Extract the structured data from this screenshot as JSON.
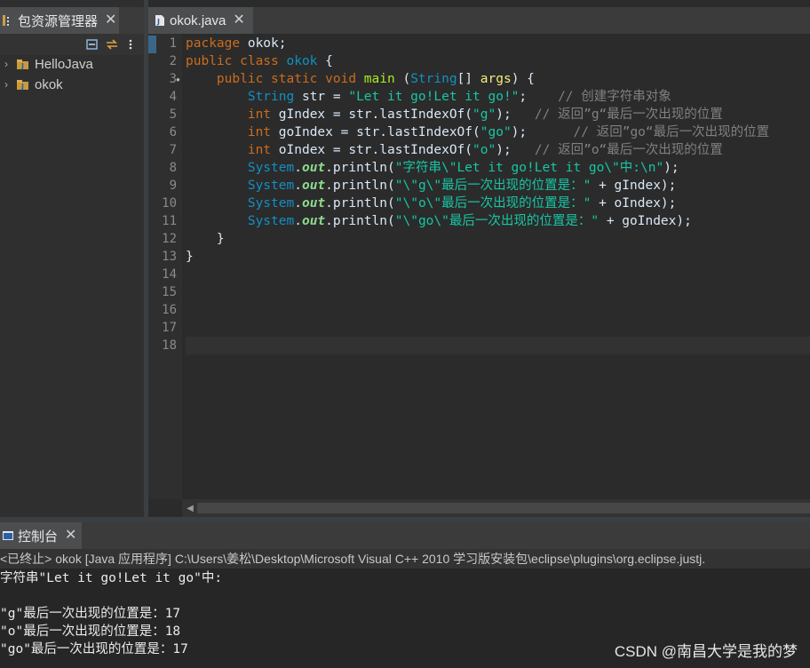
{
  "package_explorer": {
    "tab_label": "包资源管理器",
    "close": "✕",
    "projects": [
      {
        "label": "HelloJava"
      },
      {
        "label": "okok"
      }
    ]
  },
  "editor": {
    "tab_label": "okok.java",
    "close": "✕",
    "line_numbers": [
      "1",
      "2",
      "3",
      "4",
      "5",
      "6",
      "7",
      "8",
      "9",
      "10",
      "11",
      "12",
      "13",
      "14",
      "15",
      "16",
      "17",
      "18"
    ],
    "lines": {
      "l1_kw": "package",
      "l1_rest": " okok;",
      "l2_kw": "public class",
      "l2_name": " okok",
      "l2_rest": " {",
      "l3_kw": "public static void",
      "l3_name": " main",
      "l3_p1": " (",
      "l3_type": "String",
      "l3_p2": "[] ",
      "l3_args": "args",
      "l3_p3": ") {",
      "l4_type": "String",
      "l4_rest": " str = ",
      "l4_str": "\"Let it go!Let it go!\"",
      "l4_end": ";",
      "l4_cmt": "// 创建字符串对象",
      "l5_kw": "int",
      "l5_rest": " gIndex = str.lastIndexOf(",
      "l5_str": "\"g\"",
      "l5_end": ");",
      "l5_cmt": "// 返回”g“最后一次出现的位置",
      "l6_kw": "int",
      "l6_rest": " goIndex = str.lastIndexOf(",
      "l6_str": "\"go\"",
      "l6_end": ");",
      "l6_cmt": "// 返回”go“最后一次出现的位置",
      "l7_kw": "int",
      "l7_rest": " oIndex = str.lastIndexOf(",
      "l7_str": "\"o\"",
      "l7_end": ");",
      "l7_cmt": "// 返回”o“最后一次出现的位置",
      "sys": "System",
      "dot": ".",
      "out": "out",
      "println": ".println(",
      "l8_str": "\"字符串\\\"Let it go!Let it go\\\"中:\\n\"",
      "l8_end": ");",
      "l9_str": "\"\\\"g\\\"最后一次出现的位置是：\"",
      "l9_rest": " + gIndex);",
      "l10_str": "\"\\\"o\\\"最后一次出现的位置是：\"",
      "l10_rest": " + oIndex);",
      "l11_str": "\"\\\"go\\\"最后一次出现的位置是：\"",
      "l11_rest": " + goIndex);",
      "l12": "}",
      "l13": "}"
    }
  },
  "console": {
    "tab_label": "控制台",
    "close": "✕",
    "info": "<已终止> okok [Java 应用程序] C:\\Users\\姜松\\Desktop\\Microsoft Visual C++ 2010 学习版安装包\\eclipse\\plugins\\org.eclipse.justj.",
    "output": [
      "字符串\"Let it go!Let it go\"中:",
      "",
      "\"g\"最后一次出现的位置是：17",
      "\"o\"最后一次出现的位置是：18",
      "\"go\"最后一次出现的位置是：17"
    ]
  },
  "watermark": "CSDN @南昌大学是我的梦",
  "icons": {
    "package_explorer_tab": "package-explorer-icon",
    "java_file": "java-file-icon",
    "console": "console-icon",
    "collapse": "collapse-all-icon",
    "link": "link-editor-icon",
    "menu": "view-menu-icon",
    "project": "java-project-icon",
    "expand": "chevron-right-icon"
  }
}
